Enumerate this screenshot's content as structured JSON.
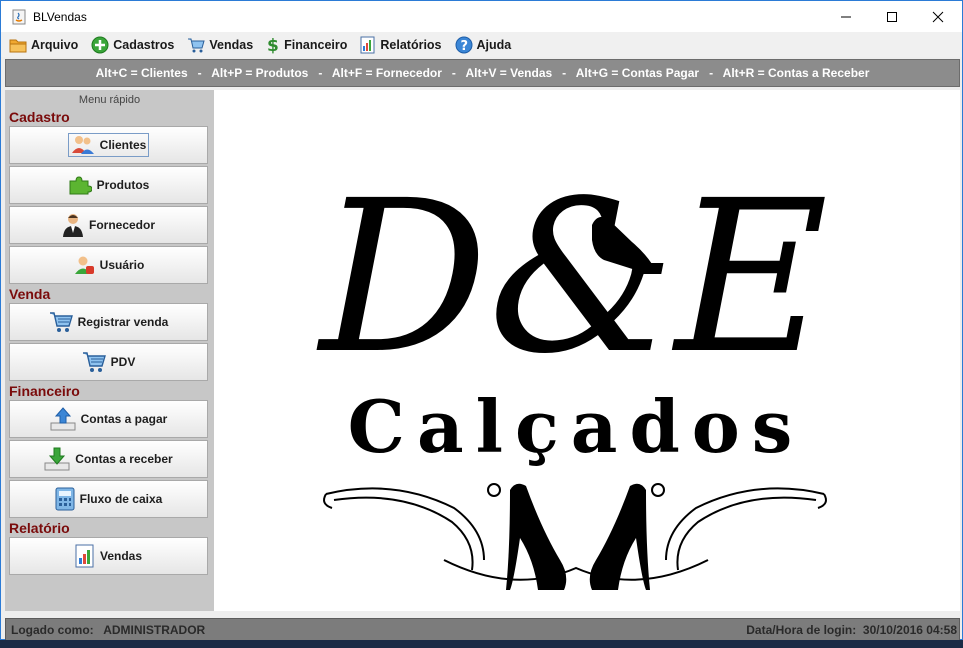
{
  "window": {
    "title": "BLVendas"
  },
  "menubar": {
    "items": [
      {
        "label": "Arquivo",
        "icon": "folder-icon"
      },
      {
        "label": "Cadastros",
        "icon": "add-circle-icon"
      },
      {
        "label": "Vendas",
        "icon": "cart-icon"
      },
      {
        "label": "Financeiro",
        "icon": "dollar-icon"
      },
      {
        "label": "Relatórios",
        "icon": "report-icon"
      },
      {
        "label": "Ajuda",
        "icon": "help-icon"
      }
    ]
  },
  "shortcut_bar": {
    "text": "Alt+C = Clientes   -   Alt+P = Produtos   -   Alt+F = Fornecedor   -   Alt+V = Vendas   -   Alt+G = Contas Pagar   -   Alt+R = Contas a Receber"
  },
  "sidebar": {
    "caption": "Menu rápido",
    "sections": [
      {
        "title": "Cadastro",
        "buttons": [
          {
            "label": "Clientes",
            "icon": "users-icon"
          },
          {
            "label": "Produtos",
            "icon": "puzzle-icon"
          },
          {
            "label": "Fornecedor",
            "icon": "supplier-icon"
          },
          {
            "label": "Usuário",
            "icon": "user-icon"
          }
        ]
      },
      {
        "title": "Venda",
        "buttons": [
          {
            "label": "Registrar venda",
            "icon": "cart-icon"
          },
          {
            "label": "PDV",
            "icon": "cart-icon"
          }
        ]
      },
      {
        "title": "Financeiro",
        "buttons": [
          {
            "label": "Contas a pagar",
            "icon": "upload-icon"
          },
          {
            "label": "Contas a receber",
            "icon": "download-icon"
          },
          {
            "label": "Fluxo de caixa",
            "icon": "calculator-icon"
          }
        ]
      },
      {
        "title": "Relatório",
        "buttons": [
          {
            "label": "Vendas",
            "icon": "report-icon"
          }
        ]
      }
    ]
  },
  "logo": {
    "monogram": "D&E",
    "brand": "Calçados"
  },
  "statusbar": {
    "left": "Logado como:   ADMINISTRADOR",
    "right": "Data/Hora de login:  30/10/2016 04:58"
  }
}
